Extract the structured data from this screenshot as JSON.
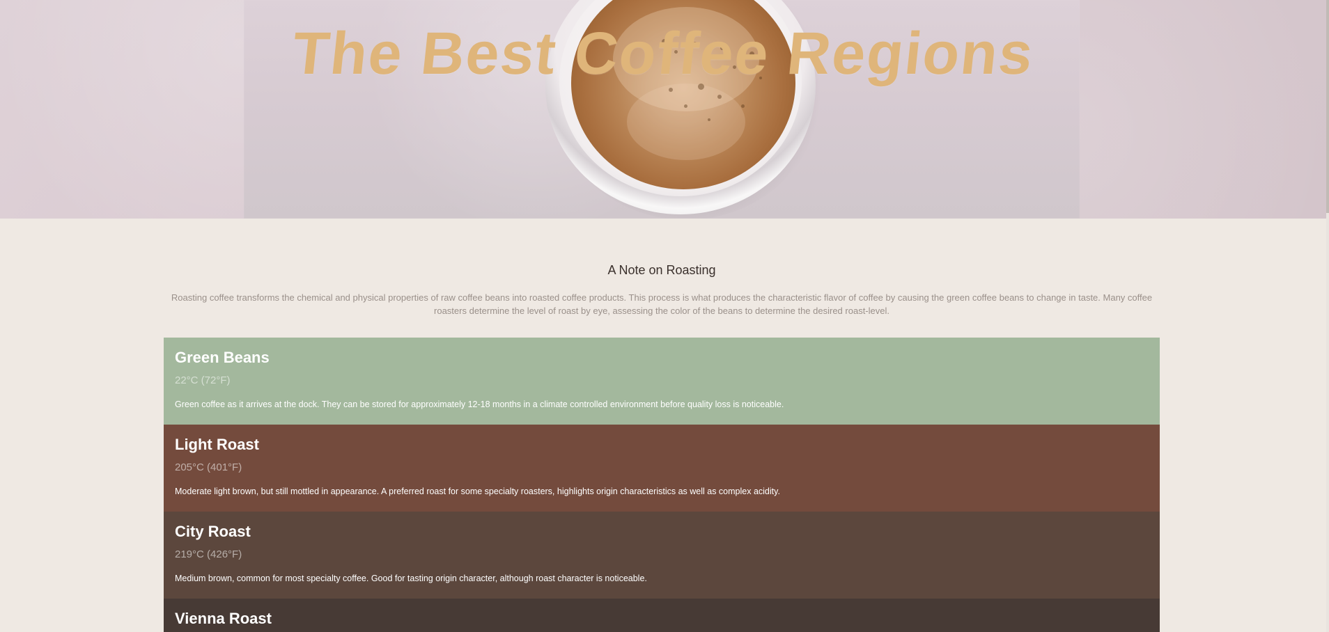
{
  "hero": {
    "title": "The Best Coffee Regions",
    "image": "coffee-cup-top-view"
  },
  "intro": {
    "title": "A Note on Roasting",
    "text": "Roasting coffee transforms the chemical and physical properties of raw coffee beans into roasted coffee products. This process is what produces the characteristic flavor of coffee by causing the green coffee beans to change in taste. Many coffee roasters determine the level of roast by eye, assessing the color of the beans to determine the desired roast-level."
  },
  "roasts": [
    {
      "name": "Green Beans",
      "temp": "22°C (72°F)",
      "description": "Green coffee as it arrives at the dock. They can be stored for approximately 12-18 months in a climate controlled environment before quality loss is noticeable.",
      "color": "#a3b89d"
    },
    {
      "name": "Light Roast",
      "temp": "205°C (401°F)",
      "description": "Moderate light brown, but still mottled in appearance. A preferred roast for some specialty roasters, highlights origin characteristics as well as complex acidity.",
      "color": "#744b3d"
    },
    {
      "name": "City Roast",
      "temp": "219°C (426°F)",
      "description": "Medium brown, common for most specialty coffee. Good for tasting origin character, although roast character is noticeable.",
      "color": "#5c473d"
    },
    {
      "name": "Vienna Roast",
      "temp": "",
      "description": "",
      "color": "#473a35"
    }
  ],
  "colors": {
    "page_background": "#efe9e3",
    "title_color": "#dfb57a",
    "intro_title_color": "#3a302c",
    "intro_text_color": "#9a908a",
    "scrollbar_track": "#e9e4df",
    "scrollbar_thumb": "#c1bbb6"
  }
}
